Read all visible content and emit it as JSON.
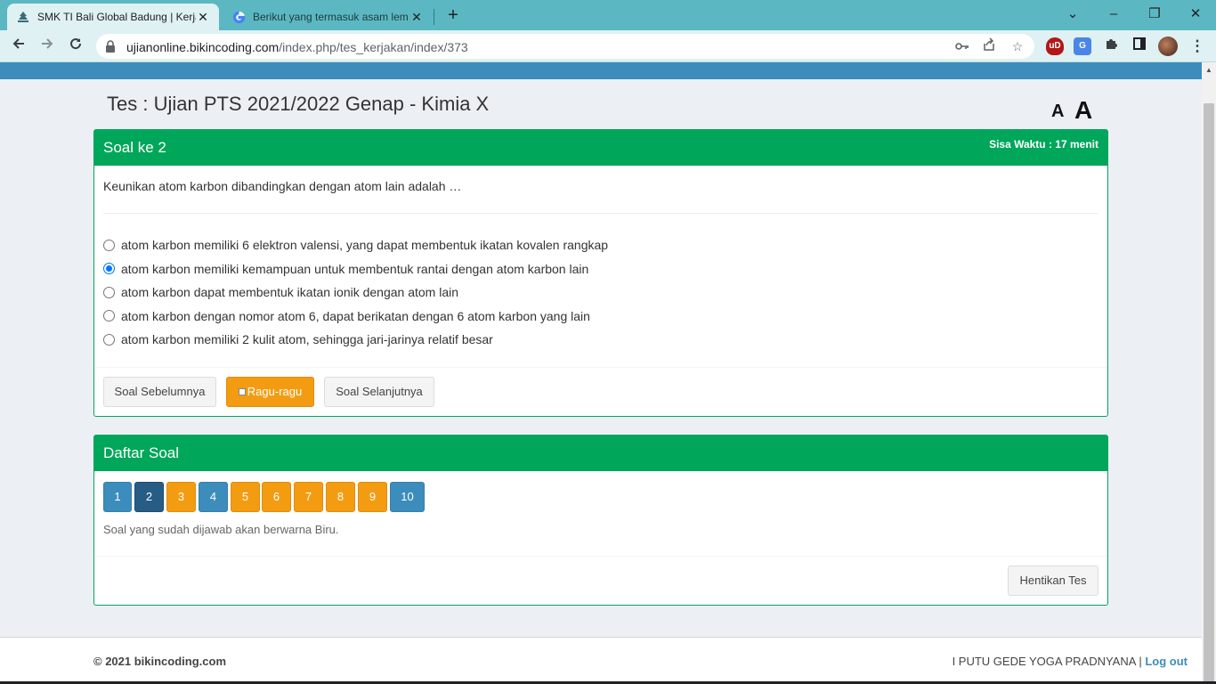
{
  "browser": {
    "tabs": [
      {
        "title": "SMK TI Bali Global Badung | Kerja",
        "active": true
      },
      {
        "title": "Berikut yang termasuk asam lem",
        "active": false
      }
    ],
    "url_host": "ujianonline.bikincoding.com",
    "url_path": "/index.php/tes_kerjakan/index/373",
    "window_controls": {
      "minimize": "–",
      "restore": "❐",
      "close": "✕"
    }
  },
  "page": {
    "title": "Tes : Ujian PTS 2021/2022 Genap - Kimia X",
    "font_small": "A",
    "font_large": "A"
  },
  "question_box": {
    "header": "Soal ke 2",
    "timer": "Sisa Waktu : 17 menit",
    "question": "Keunikan atom karbon dibandingkan dengan atom lain adalah …",
    "options": [
      {
        "text": "atom karbon memiliki 6 elektron valensi, yang dapat membentuk ikatan kovalen rangkap",
        "checked": false
      },
      {
        "text": "atom karbon memiliki kemampuan untuk membentuk rantai dengan atom karbon lain",
        "checked": true
      },
      {
        "text": "atom karbon dapat membentuk ikatan ionik dengan atom lain",
        "checked": false
      },
      {
        "text": "atom karbon dengan nomor atom 6, dapat berikatan dengan 6 atom karbon yang lain",
        "checked": false
      },
      {
        "text": "atom karbon memiliki 2 kulit atom, sehingga jari-jarinya relatif besar",
        "checked": false
      }
    ],
    "prev_label": "Soal Sebelumnya",
    "doubt_label": "Ragu-ragu",
    "next_label": "Soal Selanjutnya"
  },
  "list_box": {
    "header": "Daftar Soal",
    "numbers": [
      {
        "n": "1",
        "state": "answered"
      },
      {
        "n": "2",
        "state": "current"
      },
      {
        "n": "3",
        "state": "doubt"
      },
      {
        "n": "4",
        "state": "answered"
      },
      {
        "n": "5",
        "state": "doubt"
      },
      {
        "n": "6",
        "state": "doubt"
      },
      {
        "n": "7",
        "state": "doubt"
      },
      {
        "n": "8",
        "state": "doubt"
      },
      {
        "n": "9",
        "state": "doubt"
      },
      {
        "n": "10",
        "state": "answered"
      }
    ],
    "note": "Soal yang sudah dijawab akan berwarna Biru.",
    "stop_label": "Hentikan Tes"
  },
  "footer": {
    "copyright": "© 2021 bikincoding.com",
    "user": "I PUTU GEDE YOGA PRADNYANA",
    "separator": "|",
    "logout": "Log out"
  },
  "colors": {
    "primary": "#3c8dbc",
    "success": "#00a65a",
    "warning": "#f39c12",
    "current": "#275d84"
  }
}
